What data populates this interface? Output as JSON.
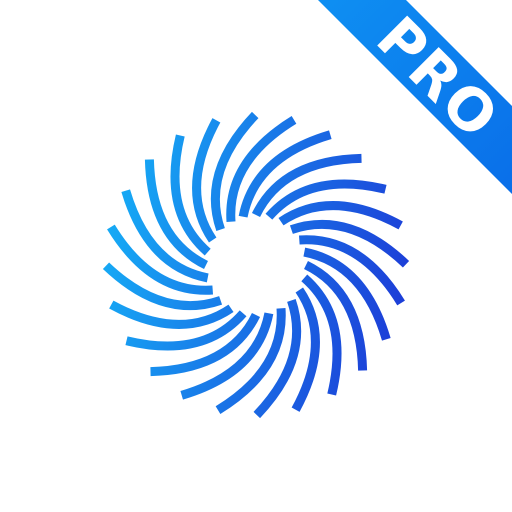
{
  "app_icon": {
    "background_color": "#ffffff",
    "logo": {
      "icon": "swirl-sun-icon",
      "colors": {
        "light_blue": "#16a9f5",
        "deep_blue": "#1c3fd8"
      },
      "blade_count": 24
    },
    "badge": {
      "label": "PRO",
      "text_color": "#ffffff",
      "colors": {
        "start": "#0e8ff2",
        "end": "#0a6fe9"
      }
    }
  }
}
